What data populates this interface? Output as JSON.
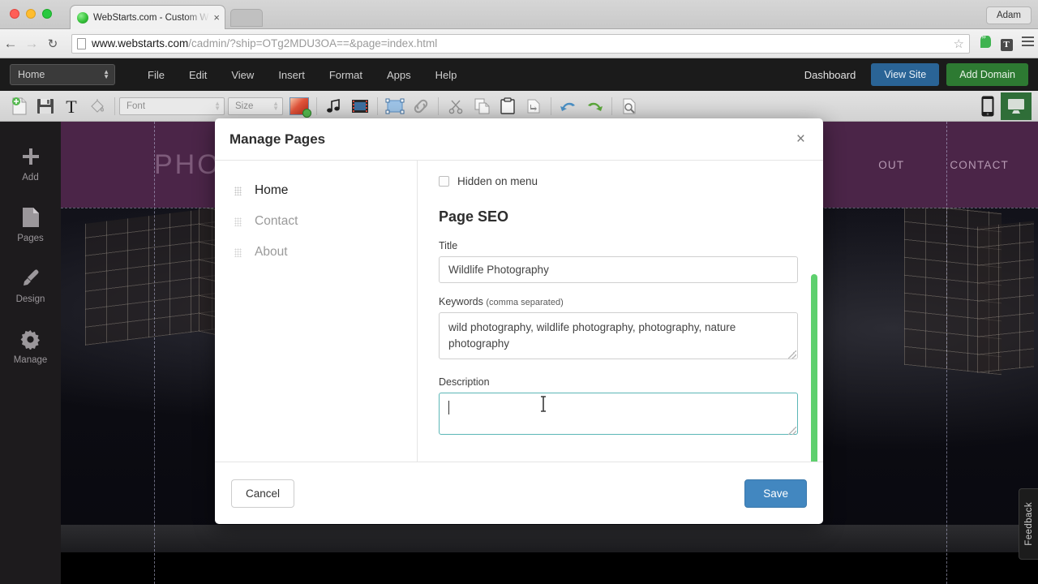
{
  "browser": {
    "tab": {
      "title": "WebStarts.com - Custom W",
      "favicon": "green-circle-favicon",
      "close": "×"
    },
    "profile_label": "Adam",
    "back_icon": "←",
    "forward_icon": "→",
    "reload_icon": "↻",
    "url_domain": "www.webstarts.com",
    "url_path": "/cadmin/?ship=OTg2MDU3OA==&page=index.html",
    "star_icon": "☆",
    "extensions": [
      "hangouts-icon",
      "t-extension-icon",
      "chrome-menu-icon"
    ]
  },
  "app": {
    "page_selector": {
      "value": "Home"
    },
    "menu": [
      "File",
      "Edit",
      "View",
      "Insert",
      "Format",
      "Apps",
      "Help"
    ],
    "dashboard_label": "Dashboard",
    "view_site_label": "View Site",
    "add_domain_label": "Add Domain",
    "view_site_color": "#2a6496",
    "add_domain_color": "#2d7a32",
    "toolbar": {
      "font_placeholder": "Font",
      "size_placeholder": "Size",
      "icons": [
        "new-page-icon",
        "save-icon",
        "text-icon",
        "paint-bucket-icon",
        "color-swatch-icon",
        "audio-icon",
        "video-icon",
        "shape-icon",
        "link-icon",
        "cut-icon",
        "copy-icon",
        "paste-icon",
        "paste-special-icon",
        "undo-icon",
        "redo-icon",
        "preview-icon",
        "mobile-view-icon",
        "desktop-view-icon"
      ]
    },
    "sidebar": [
      {
        "label": "Add",
        "icon": "plus-icon"
      },
      {
        "label": "Pages",
        "icon": "page-icon"
      },
      {
        "label": "Design",
        "icon": "paintbrush-icon"
      },
      {
        "label": "Manage",
        "icon": "gear-icon"
      }
    ]
  },
  "site": {
    "logo": "PHOT",
    "nav": [
      "OUT",
      "CONTACT"
    ],
    "header_color": "#4b2548",
    "feedback_label": "Feedback"
  },
  "modal": {
    "title": "Manage Pages",
    "close_icon": "×",
    "pages": [
      {
        "name": "Home",
        "active": true
      },
      {
        "name": "Contact",
        "active": false
      },
      {
        "name": "About",
        "active": false
      }
    ],
    "hidden_on_menu": {
      "label": "Hidden on menu",
      "checked": false
    },
    "seo_heading": "Page SEO",
    "fields": {
      "title": {
        "label": "Title",
        "value": "Wildlife Photography",
        "placeholder": ""
      },
      "keywords": {
        "label": "Keywords",
        "hint": "(comma separated)",
        "value": "wild photography, wildlife photography, photography, nature photography",
        "placeholder": ""
      },
      "description": {
        "label": "Description",
        "value": "",
        "placeholder": "",
        "focused": true
      }
    },
    "scrollbar_color": "#5ed06e",
    "cancel_label": "Cancel",
    "save_label": "Save",
    "save_color": "#4287c0"
  }
}
